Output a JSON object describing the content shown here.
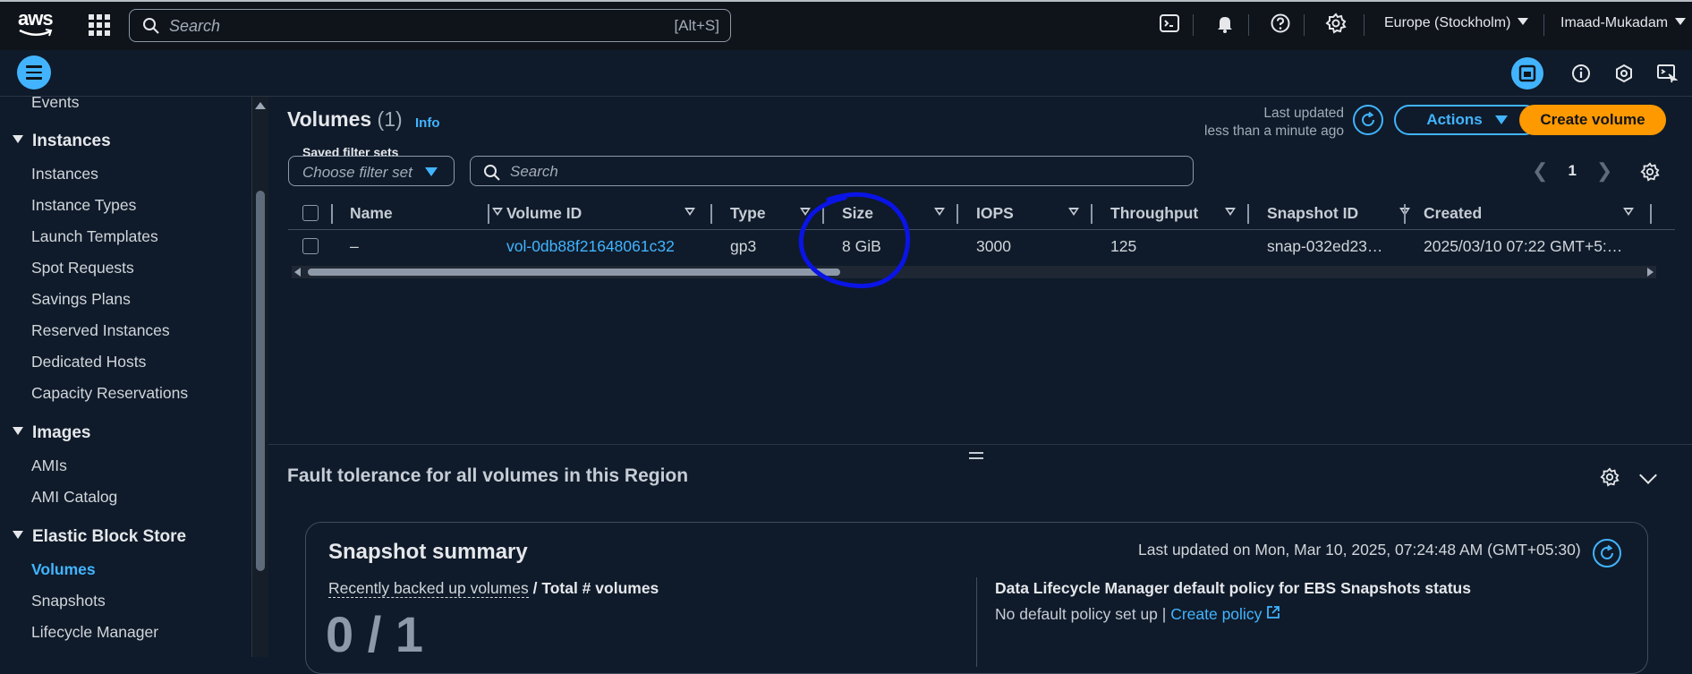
{
  "topbar": {
    "logo_text": "aws",
    "search_placeholder": "Search",
    "search_shortcut": "[Alt+S]",
    "region": "Europe (Stockholm)",
    "user": "Imaad-Mukadam"
  },
  "sidebar": {
    "items_top": [
      {
        "label": "Events"
      }
    ],
    "instances": {
      "title": "Instances",
      "items": [
        {
          "label": "Instances"
        },
        {
          "label": "Instance Types"
        },
        {
          "label": "Launch Templates"
        },
        {
          "label": "Spot Requests"
        },
        {
          "label": "Savings Plans"
        },
        {
          "label": "Reserved Instances"
        },
        {
          "label": "Dedicated Hosts"
        },
        {
          "label": "Capacity Reservations"
        }
      ]
    },
    "images": {
      "title": "Images",
      "items": [
        {
          "label": "AMIs"
        },
        {
          "label": "AMI Catalog"
        }
      ]
    },
    "ebs": {
      "title": "Elastic Block Store",
      "items": [
        {
          "label": "Volumes"
        },
        {
          "label": "Snapshots"
        },
        {
          "label": "Lifecycle Manager"
        }
      ]
    }
  },
  "volumes": {
    "title": "Volumes",
    "count": "(1)",
    "info": "Info",
    "last_updated_label": "Last updated",
    "last_updated_value": "less than a minute ago",
    "actions_label": "Actions",
    "create_label": "Create volume",
    "saved_filter_label": "Saved filter sets",
    "saved_filter_placeholder": "Choose filter set",
    "search_placeholder": "Search",
    "page": "1",
    "columns": [
      "Name",
      "Volume ID",
      "Type",
      "Size",
      "IOPS",
      "Throughput",
      "Snapshot ID",
      "Created"
    ],
    "rows": [
      {
        "name": "–",
        "volume_id": "vol-0db88f21648061c32",
        "type": "gp3",
        "size": "8 GiB",
        "iops": "3000",
        "throughput": "125",
        "snapshot_id": "snap-032ed23…",
        "created": "2025/03/10 07:22 GMT+5:…"
      }
    ]
  },
  "fault": {
    "title": "Fault tolerance for all volumes in this Region"
  },
  "snapshot_summary": {
    "title": "Snapshot summary",
    "last_updated": "Last updated on Mon, Mar 10, 2025, 07:24:48 AM (GMT+05:30)",
    "recent_label": "Recently backed up volumes",
    "total_label": " / Total # volumes",
    "ratio": "0 / 1",
    "dlm_title": "Data Lifecycle Manager default policy for EBS Snapshots status",
    "no_policy": "No default policy set up | ",
    "create_policy": "Create policy"
  },
  "colors": {
    "accent": "#42b4ff",
    "primary_button": "#ff9900",
    "annotation_circle": "#0a14e6",
    "background": "#0f1b2a"
  }
}
